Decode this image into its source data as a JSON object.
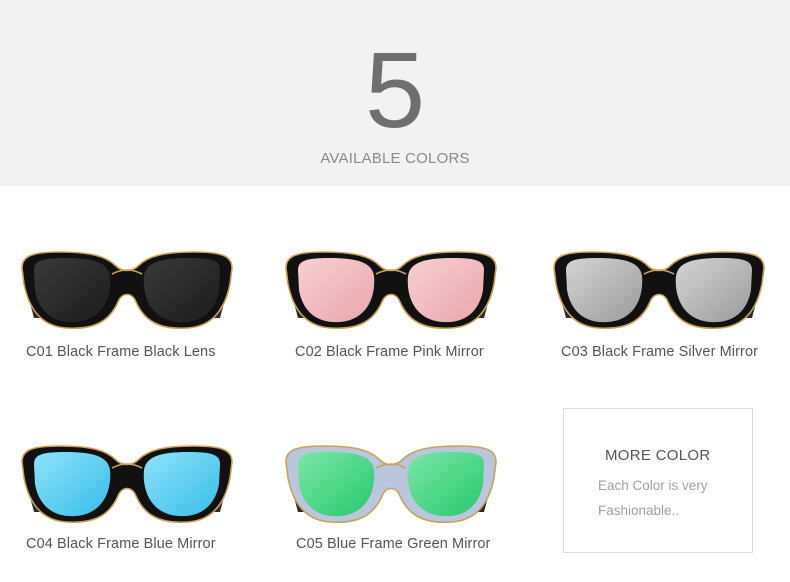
{
  "header": {
    "count": "5",
    "title": "AVAILABLE COLORS"
  },
  "products": [
    {
      "code": "C01",
      "label": "C01 Black Frame Black Lens",
      "frame_color": "#111111",
      "lens_color": "#1c1c1c",
      "lens_highlight": "#3a3a3a"
    },
    {
      "code": "C02",
      "label": "C02 Black Frame Pink Mirror",
      "frame_color": "#111111",
      "lens_color": "#e9a6ae",
      "lens_highlight": "#f7cfd3"
    },
    {
      "code": "C03",
      "label": "C03 Black Frame Silver Mirror",
      "frame_color": "#111111",
      "lens_color": "#9a9a9a",
      "lens_highlight": "#d4d4d4"
    },
    {
      "code": "C04",
      "label": "C04 Black Frame Blue Mirror",
      "frame_color": "#111111",
      "lens_color": "#38bde8",
      "lens_highlight": "#8ee2fa"
    },
    {
      "code": "C05",
      "label": "C05 Blue Frame Green Mirror",
      "frame_color": "#b9c6dc",
      "lens_color": "#26c86e",
      "lens_highlight": "#7be6a8"
    }
  ],
  "more_color": {
    "title": "MORE COLOR",
    "line1": "Each Color is very",
    "line2": "Fashionable.."
  }
}
